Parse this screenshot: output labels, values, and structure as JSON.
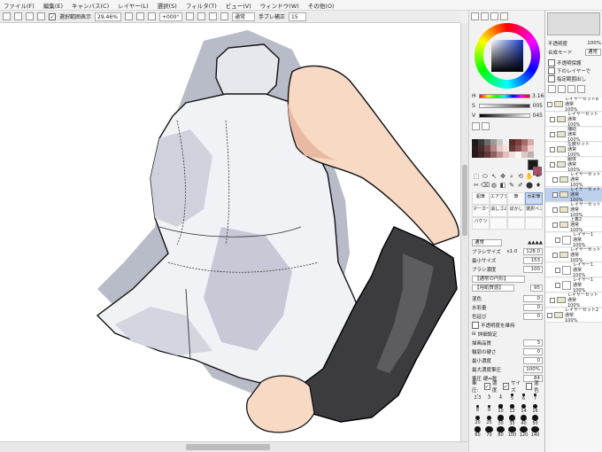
{
  "menu": [
    "ファイル(F)",
    "編集(E)",
    "キャンバス(C)",
    "レイヤー(L)",
    "選択(S)",
    "フィルタ(T)",
    "ビュー(V)",
    "ウィンドウ(W)",
    "その他(O)"
  ],
  "toolbar": {
    "selection_label": "選択範囲表示",
    "zoom": "29.46%",
    "rotation": "+000°",
    "blend": "通常",
    "stabilizer_label": "手ブレ補正",
    "stabilizer_value": "15"
  },
  "color": {
    "h_label": "H",
    "h_value": "3.164",
    "s_label": "S",
    "s_value": "005",
    "v_label": "V",
    "v_value": "045",
    "swatches": [
      "#1b1b1b",
      "#3a3a3a",
      "#6b6b6b",
      "#9a9a9a",
      "#c9c9c9",
      "#efefef",
      "#5a2b2b",
      "#7a3f3f",
      "#a56a6a",
      "#d9a9a9",
      "#2b1a1a",
      "#4a2a2a",
      "#7a4a4a",
      "#b88585",
      "#e8c8c8",
      "#f6e2d8",
      "#623a3a",
      "#8c5555",
      "#c08a8a",
      "#f0d4cc",
      "#241818",
      "#3c2525",
      "#5e3a3a",
      "#925f5f",
      "#bf8e8e",
      "#e3bcbc",
      "#f3dede",
      "#fff6f2",
      "#d8c8c8",
      "#bfb0b0"
    ],
    "fg": "#1b1b1b",
    "bg": "#b24a6a"
  },
  "tools": {
    "glyphs": [
      "⬚",
      "⬭",
      "↖",
      "✥",
      "⌕",
      "⟲",
      "✋",
      "✒",
      "✂",
      "⌫",
      "◍",
      "◧",
      "✎",
      "✐",
      "⬤",
      "♦"
    ],
    "subtools": [
      "鉛筆",
      "エアブラシ",
      "筆",
      "水彩筆",
      "マーカー",
      "消しゴム",
      "ぼかし",
      "選択ペン",
      "バケツ",
      "",
      "",
      ""
    ],
    "selected_subtool": 3
  },
  "brush": {
    "blend_mode": "通常",
    "size_label": "ブラシサイズ",
    "size_mult": "x1.0",
    "size_value": "128.0",
    "min_size_label": "最小サイズ",
    "min_size_value": "153",
    "density_label": "ブラシ濃度",
    "density_value": "100",
    "shape": "【通常の円形】",
    "texture": "【用紙質感】",
    "texture_strength": "95",
    "mix_label": "混色",
    "mix_value": "0",
    "water_label": "水彩量",
    "water_value": "0",
    "persist_label": "色延び",
    "persist_value": "0",
    "keep_opacity_label": "不透明度を維持",
    "detail_label": "詳細設定",
    "quality_label": "描画品質",
    "quality_value": "3",
    "edge_label": "輪郭の硬さ",
    "edge_value": "0",
    "min_density_label": "最小濃度",
    "min_density_value": "0",
    "max_pressure_label": "最大濃度筆圧",
    "max_pressure_value": "100%",
    "pressure_label": "筆圧 硬⇔軟",
    "pressure_value": "84",
    "pressure_opts": [
      "筆圧:",
      "濃度",
      "サイズ",
      "混色"
    ],
    "sizes": [
      "2.3",
      "3",
      "4",
      "5",
      "6",
      "7",
      "8",
      "9",
      "10",
      "12",
      "14",
      "16",
      "20",
      "25",
      "30",
      "35",
      "40",
      "50",
      "60",
      "70",
      "80",
      "100",
      "120",
      "140"
    ]
  },
  "layers": {
    "opacity_label": "不透明度",
    "opacity_value": "100%",
    "blend_mode_label": "合成モード",
    "blend_mode": "通常",
    "protect_label": "不透明保護",
    "clip_label": "下のレイヤーで",
    "select_label": "指定範囲出し",
    "items": [
      {
        "name": "レイヤーセット8",
        "mode": "通常",
        "opacity": "100%",
        "type": "folder",
        "indent": 0,
        "selected": false
      },
      {
        "name": "レイヤーセット",
        "mode": "通常",
        "opacity": "100%",
        "type": "folder",
        "indent": 1,
        "selected": false
      },
      {
        "name": "補助",
        "mode": "通常",
        "opacity": "100%",
        "type": "folder",
        "indent": 1,
        "selected": false
      },
      {
        "name": "左腕セット",
        "mode": "通常",
        "opacity": "100%",
        "type": "folder",
        "indent": 1,
        "selected": false
      },
      {
        "name": "胴体",
        "mode": "通常",
        "opacity": "100%",
        "type": "folder",
        "indent": 1,
        "selected": false
      },
      {
        "name": "レイヤーセット",
        "mode": "通常",
        "opacity": "100%",
        "type": "folder",
        "indent": 2,
        "selected": false
      },
      {
        "name": "レイヤーセット",
        "mode": "通常",
        "opacity": "100%",
        "type": "folder",
        "indent": 2,
        "selected": true
      },
      {
        "name": "レイヤーセット",
        "mode": "通常",
        "opacity": "100%",
        "type": "folder",
        "indent": 2,
        "selected": false
      },
      {
        "name": "上着2",
        "mode": "通常",
        "opacity": "100%",
        "type": "folder",
        "indent": 2,
        "selected": false
      },
      {
        "name": "レイヤー1",
        "mode": "通常",
        "opacity": "100%",
        "type": "layer",
        "indent": 3,
        "selected": false
      },
      {
        "name": "レイヤーセット",
        "mode": "通常",
        "opacity": "100%",
        "type": "folder",
        "indent": 2,
        "selected": false
      },
      {
        "name": "レイヤー1",
        "mode": "通常",
        "opacity": "100%",
        "type": "layer",
        "indent": 3,
        "selected": false
      },
      {
        "name": "レイヤー1",
        "mode": "通常",
        "opacity": "100%",
        "type": "layer",
        "indent": 3,
        "selected": false
      },
      {
        "name": "レイヤーセット",
        "mode": "通常",
        "opacity": "100%",
        "type": "folder",
        "indent": 1,
        "selected": false
      },
      {
        "name": "レイヤーセット2",
        "mode": "通常",
        "opacity": "100%",
        "type": "folder",
        "indent": 0,
        "selected": false
      }
    ]
  }
}
